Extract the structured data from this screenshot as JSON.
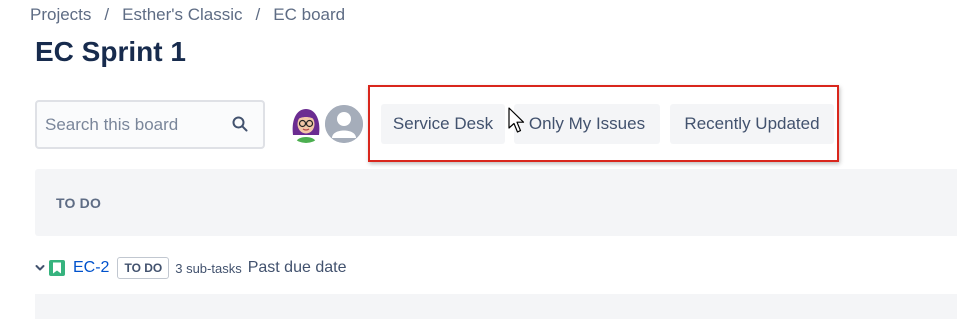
{
  "breadcrumb": {
    "items": [
      "Projects",
      "Esther's Classic",
      "EC board"
    ],
    "separator": "/"
  },
  "page_title": "EC Sprint 1",
  "search": {
    "placeholder": "Search this board",
    "value": "",
    "icon": "search-icon"
  },
  "avatars": [
    {
      "icon": "user-avatar-illustrated"
    },
    {
      "icon": "default-user-avatar"
    }
  ],
  "quick_filters": {
    "highlight_color": "#D9261C",
    "items": [
      {
        "label": "Service Desk"
      },
      {
        "label": "Only My Issues"
      },
      {
        "label": "Recently Updated"
      }
    ]
  },
  "board": {
    "column_header": "TO DO",
    "swimlane": {
      "issue_key": "EC-2",
      "status": "TO DO",
      "subtasks": "3 sub-tasks",
      "due": "Past due date",
      "issue_type_icon": "story-icon",
      "issue_type_color": "#36B37E"
    }
  },
  "colors": {
    "link": "#0052CC",
    "text_primary": "#172B4D",
    "text_secondary": "#5E6C84",
    "filter_bg": "#F4F5F7"
  }
}
